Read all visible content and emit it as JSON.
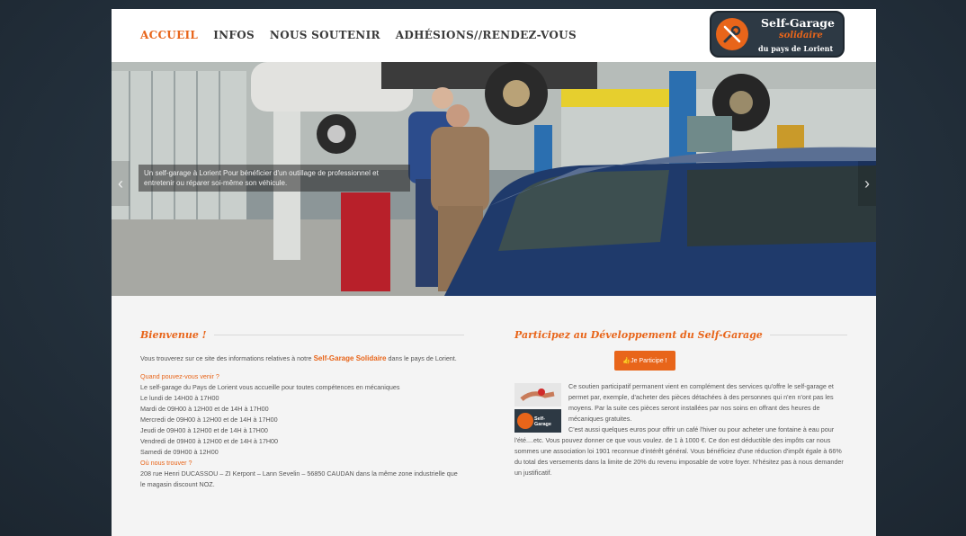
{
  "nav": {
    "items": [
      {
        "label": "ACCUEIL",
        "active": true
      },
      {
        "label": "INFOS",
        "active": false
      },
      {
        "label": "NOUS SOUTENIR",
        "active": false
      },
      {
        "label": "ADHÉSIONS//RENDEZ-VOUS",
        "active": false
      }
    ]
  },
  "logo": {
    "line1": "Self-Garage",
    "line2": "solidaire",
    "line3": "du pays de Lorient",
    "icon": "wrench-screwdriver-icon"
  },
  "slider": {
    "caption": "Un self-garage à Lorient Pour bénéficier d'un outillage de professionnel et entretenir ou réparer soi-même son véhicule.",
    "prev_icon": "chevron-left-icon",
    "next_icon": "chevron-right-icon"
  },
  "welcome": {
    "title": "Bienvenue !",
    "intro_before": "Vous trouverez sur ce site des informations relatives à notre",
    "intro_highlight": "Self-Garage Solidaire",
    "intro_after": "dans le pays de Lorient.",
    "when_heading": "Quand pouvez-vous venir ?",
    "when_text": "Le self-garage du Pays de Lorient vous accueille pour toutes compétences en mécaniques",
    "hours": [
      "Le lundi de 14H00 à 17H00",
      "Mardi de 09H00 à 12H00 et de  14H à 17H00",
      "Mercredi de 09H00 à 12H00 et de  14H à 17H00",
      "Jeudi de 09H00 à 12H00 et de  14H à 17H00",
      "Vendredi de 09H00 à 12H00 et de  14H à 17H00",
      "Samedi de 09H00 à 12H00"
    ],
    "where_heading": "Où nous trouver ?",
    "address": "208 rue Henri DUCASSOU – ZI Kerpont – Lann Sevelin – 56850 CAUDAN dans la même zone industrielle que le magasin discount NOZ."
  },
  "participate": {
    "title": "Participez au Développement du Self-Garage",
    "button_label": "Je Participe !",
    "button_icon": "thumbs-up-icon",
    "para1": "Ce soutien participatif permanent vient en complément des services qu'offre le self-garage et permet par, exemple, d'acheter des pièces détachées à des personnes qui n'en n'ont pas les moyens. Par la suite ces pièces seront installées par nos soins en offrant des heures de mécaniques gratuites.",
    "para2": "C'est aussi quelques euros pour offrir un café l'hiver ou pour acheter une fontaine à eau pour l'été....etc. Vous pouvez donner ce que vous voulez. de 1 à 1000 €. Ce don est déductible des impôts car nous sommes une association loi 1901 reconnue d'intérêt général. Vous bénéficiez d'une réduction d'impôt égale à 66% du total des versements dans la limite de 20% du revenu imposable de votre foyer. N'hésitez pas à nous demander un justificatif.",
    "thumb2_label": "Self-Garage"
  },
  "colors": {
    "accent": "#e8651a",
    "dark": "#2d3944"
  }
}
